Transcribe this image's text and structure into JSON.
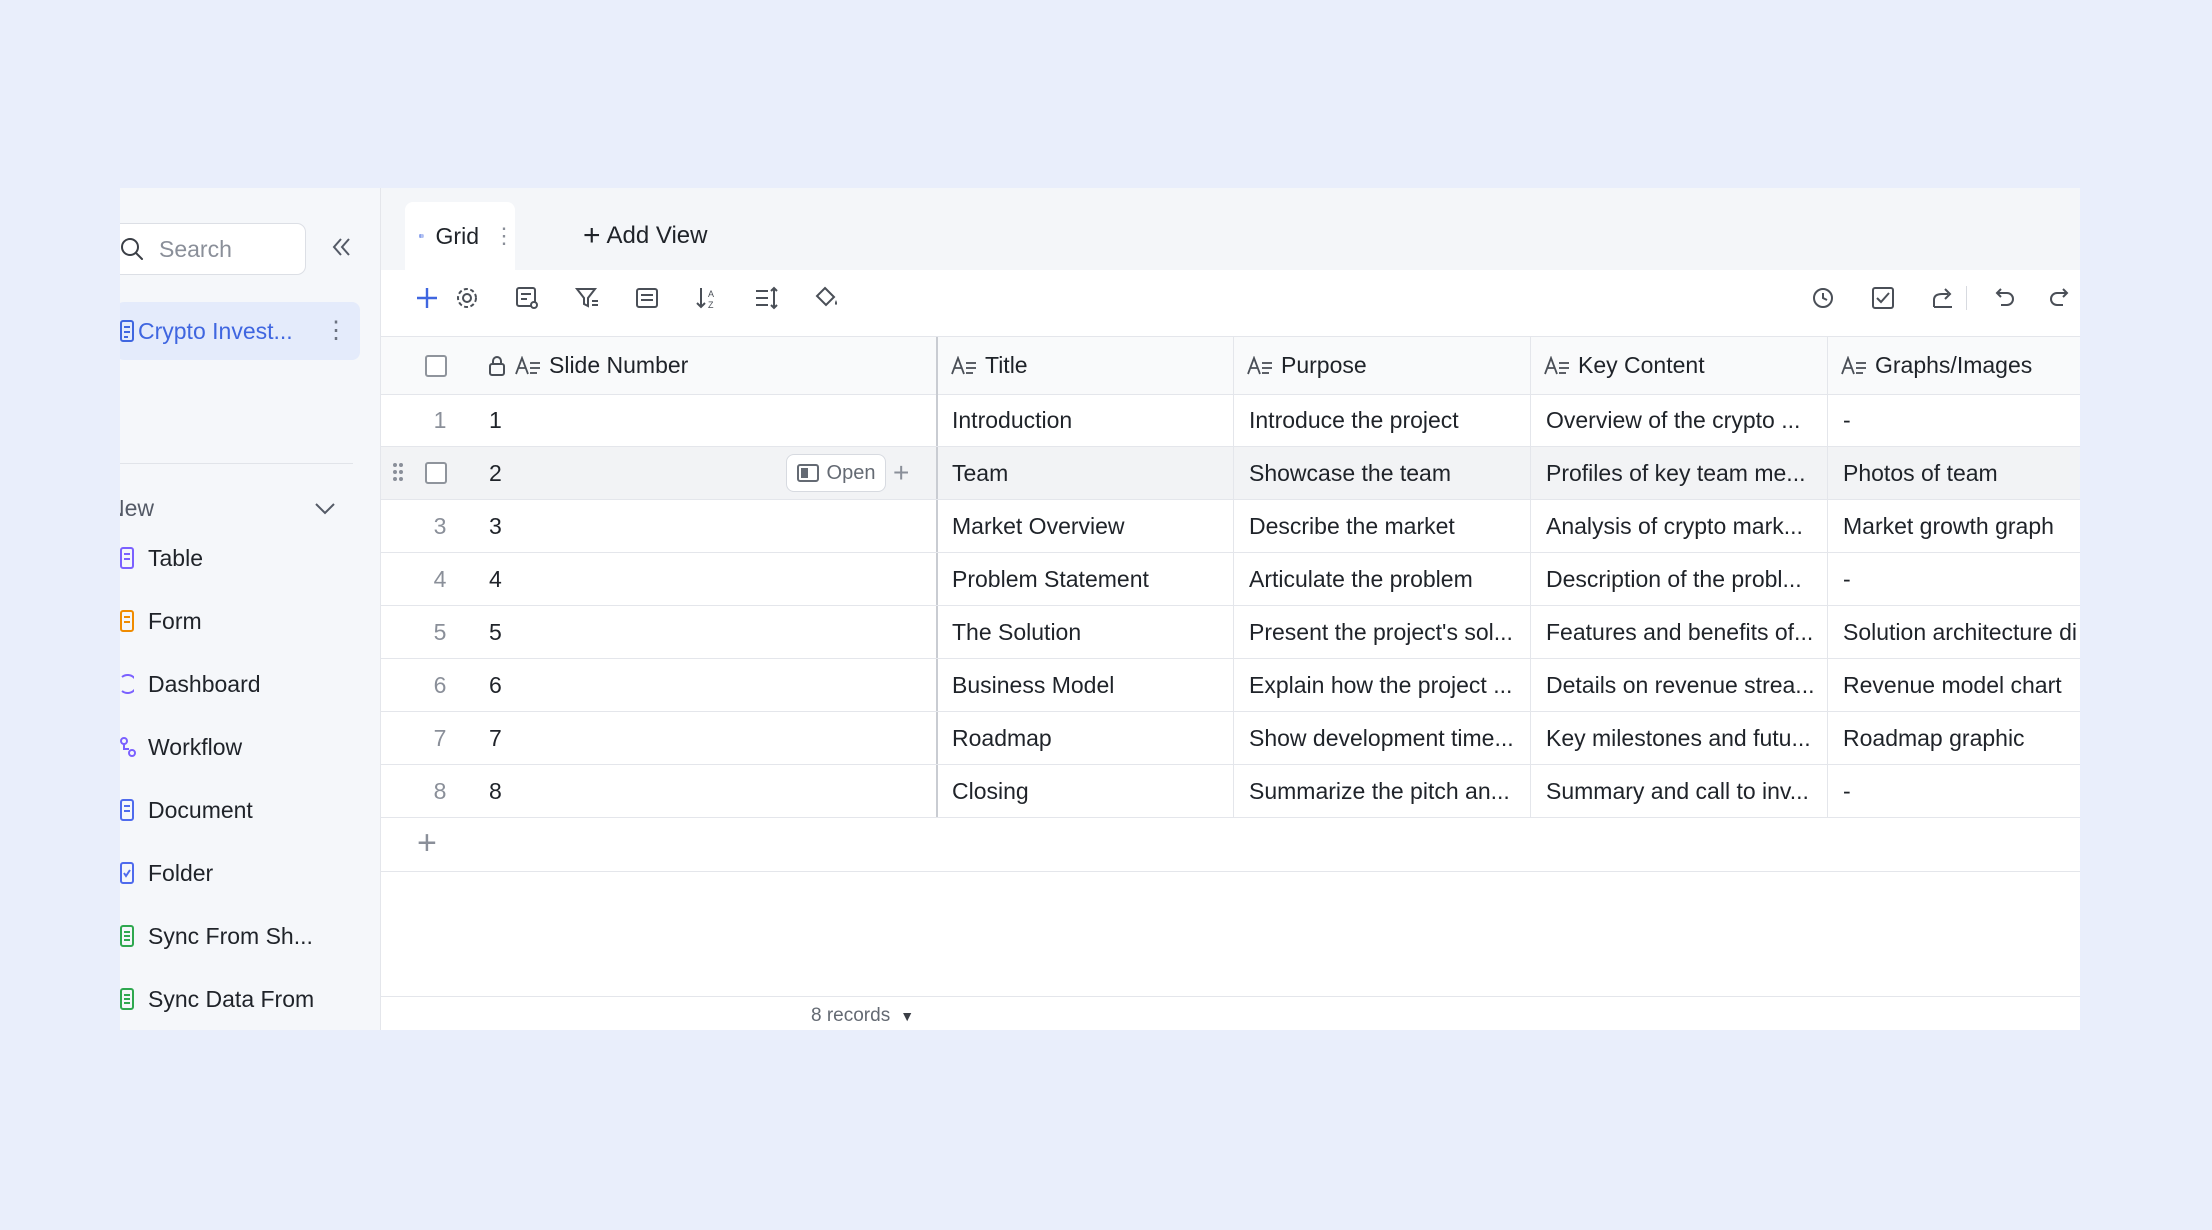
{
  "sidebar": {
    "search_placeholder": "Search",
    "active_item": "Crypto Invest...",
    "new_label": "New",
    "items": [
      {
        "label": "Table",
        "icon": "table-icon",
        "color": "#7b61ff"
      },
      {
        "label": "Form",
        "icon": "form-icon",
        "color": "#f08c00"
      },
      {
        "label": "Dashboard",
        "icon": "dashboard-icon",
        "color": "#7b61ff"
      },
      {
        "label": "Workflow",
        "icon": "workflow-icon",
        "color": "#7b61ff"
      },
      {
        "label": "Document",
        "icon": "document-icon",
        "color": "#4f6bed"
      },
      {
        "label": "Folder",
        "icon": "folder-icon",
        "color": "#4f6bed"
      },
      {
        "label": "Sync From Sh...",
        "icon": "sync-sheet-icon",
        "color": "#2fa84f"
      },
      {
        "label": "Sync Data From",
        "icon": "sync-data-icon",
        "color": "#2fa84f"
      }
    ]
  },
  "tabs": {
    "grid_label": "Grid",
    "add_view_label": "Add View"
  },
  "table": {
    "columns": [
      "Slide Number",
      "Title",
      "Purpose",
      "Key Content",
      "Graphs/Images"
    ],
    "rows": [
      {
        "num": "1",
        "slide": "1",
        "title": "Introduction",
        "purpose": "Introduce the project",
        "content": "Overview of the crypto ...",
        "graphs": "-"
      },
      {
        "num": "2",
        "slide": "2",
        "title": "Team",
        "purpose": "Showcase the team",
        "content": "Profiles of key team me...",
        "graphs": "Photos of team"
      },
      {
        "num": "3",
        "slide": "3",
        "title": "Market Overview",
        "purpose": "Describe the market",
        "content": "Analysis of crypto mark...",
        "graphs": "Market growth graph"
      },
      {
        "num": "4",
        "slide": "4",
        "title": "Problem Statement",
        "purpose": "Articulate the problem",
        "content": "Description of the probl...",
        "graphs": "-"
      },
      {
        "num": "5",
        "slide": "5",
        "title": "The Solution",
        "purpose": "Present the project's sol...",
        "content": "Features and benefits of...",
        "graphs": "Solution architecture di"
      },
      {
        "num": "6",
        "slide": "6",
        "title": "Business Model",
        "purpose": "Explain how the project ...",
        "content": "Details on revenue strea...",
        "graphs": "Revenue model chart"
      },
      {
        "num": "7",
        "slide": "7",
        "title": "Roadmap",
        "purpose": "Show development time...",
        "content": "Key milestones and futu...",
        "graphs": "Roadmap graphic"
      },
      {
        "num": "8",
        "slide": "8",
        "title": "Closing",
        "purpose": "Summarize the pitch an...",
        "content": "Summary and call to inv...",
        "graphs": "-"
      }
    ],
    "open_label": "Open",
    "records_label": "8 records"
  },
  "colors": {
    "accent": "#3f66e0",
    "background": "#e9eefb",
    "sidebar_active_bg": "#e4ebfb"
  }
}
